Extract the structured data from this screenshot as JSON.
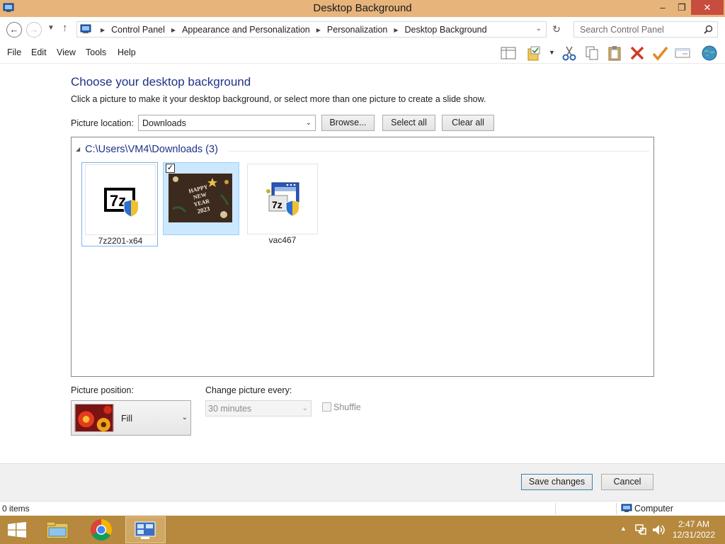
{
  "window": {
    "title": "Desktop Background",
    "minimize_glyph": "–",
    "maximize_glyph": "❐",
    "close_glyph": "✕"
  },
  "address": {
    "breadcrumb": [
      "Control Panel",
      "Appearance and Personalization",
      "Personalization",
      "Desktop Background"
    ],
    "search_placeholder": "Search Control Panel"
  },
  "menu": [
    "File",
    "Edit",
    "View",
    "Tools",
    "Help"
  ],
  "content": {
    "heading": "Choose your desktop background",
    "subtext": "Click a picture to make it your desktop background, or select more than one picture to create a slide show.",
    "location_label": "Picture location:",
    "location_value": "Downloads",
    "browse_label": "Browse...",
    "select_all_label": "Select all",
    "clear_all_label": "Clear all",
    "group_header": "C:\\Users\\VM4\\Downloads (3)",
    "pictures": [
      {
        "caption": "7z2201-x64",
        "checked": false,
        "focused": true,
        "icon": "7zip-installer-icon"
      },
      {
        "caption": "",
        "checked": true,
        "focused": false,
        "image_text": [
          "HAPPY",
          "NEW",
          "YEAR",
          "2023"
        ]
      },
      {
        "caption": "vac467",
        "checked": false,
        "focused": false,
        "icon": "7zip-app-icon"
      }
    ],
    "position_label": "Picture position:",
    "position_value": "Fill",
    "interval_label": "Change picture every:",
    "interval_value": "30 minutes",
    "shuffle_label": "Shuffle",
    "shuffle_checked": false
  },
  "footer": {
    "save_label": "Save changes",
    "cancel_label": "Cancel"
  },
  "status": {
    "items": "0 items",
    "location": "Computer"
  },
  "taskbar": {
    "time": "2:47 AM",
    "date": "12/31/2022"
  },
  "colors": {
    "title_bar": "#e7b47c",
    "taskbar": "#b6893f",
    "heading": "#1e3287",
    "selection": "#cce8ff"
  }
}
